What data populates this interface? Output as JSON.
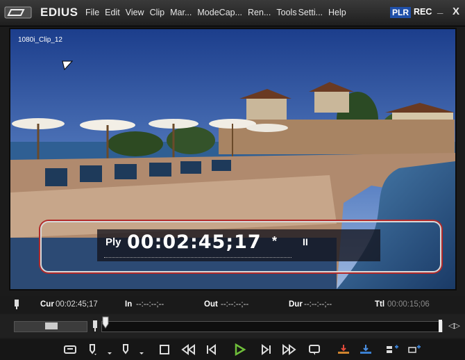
{
  "app": {
    "name": "EDIUS"
  },
  "menu": [
    "File",
    "Edit",
    "View",
    "Clip",
    "Mar...",
    "Mode",
    "Cap...",
    "Ren...",
    "Tools",
    "Setti...",
    "Help"
  ],
  "mode": {
    "plr": "PLR",
    "rec": "REC"
  },
  "window_buttons": {
    "minimize": "_",
    "close": "X"
  },
  "viewer": {
    "clip_name": "1080i_Clip_12",
    "overlay": {
      "status": "Ply",
      "timecode": "00:02:45;17",
      "marker": "*",
      "pause": "II"
    }
  },
  "info": {
    "cur_label": "Cur",
    "cur_value": "00:02:45;17",
    "in_label": "In",
    "in_value": "--:--:--;--",
    "out_label": "Out",
    "out_value": "--:--:--;--",
    "dur_label": "Dur",
    "dur_value": "--:--:--;--",
    "ttl_label": "Ttl",
    "ttl_value": "00:00:15;06"
  },
  "colors": {
    "accent_play": "#6fbf3a",
    "plr_bg": "#1f4fa8",
    "highlight": "#b32a2a"
  },
  "transport_icons": [
    "clip-monitor-icon",
    "set-in-icon",
    "set-out-icon",
    "stop-icon",
    "rewind-icon",
    "step-back-icon",
    "play-icon",
    "step-forward-icon",
    "fast-forward-icon",
    "loop-playback-icon",
    "insert-to-timeline-icon",
    "overwrite-to-timeline-icon",
    "add-marker-icon",
    "settings-icon"
  ]
}
